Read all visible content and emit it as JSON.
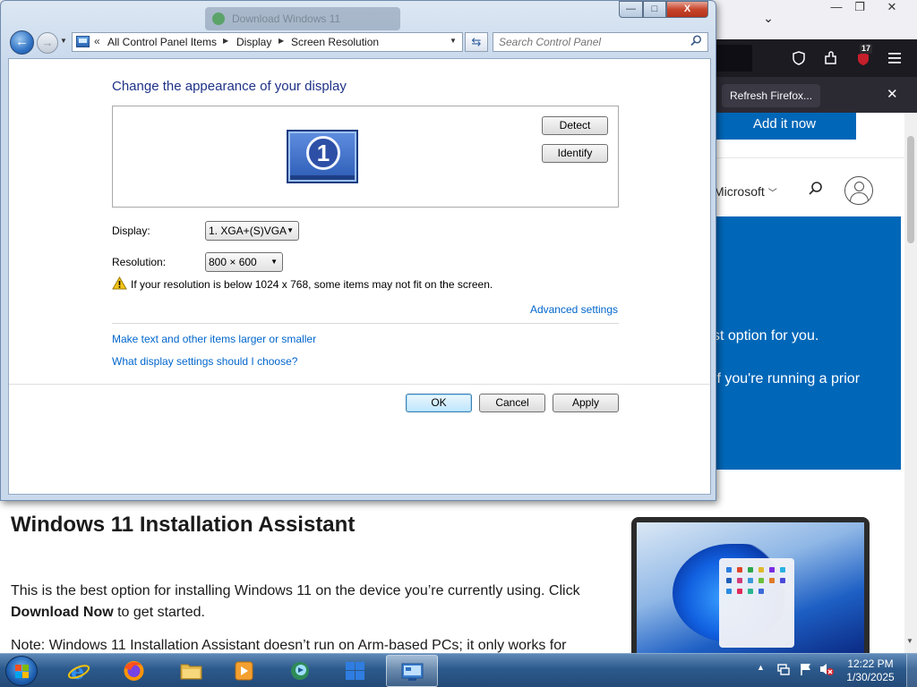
{
  "firefox": {
    "notification_button": "Refresh Firefox...",
    "notification_close": "✕",
    "tabstrip_chevron": "⌄",
    "badge_count": "17",
    "window_buttons": {
      "minimize": "—",
      "restore": "❐",
      "close": "✕"
    },
    "nav_icons": [
      "shield-icon",
      "extensions-icon",
      "ublock-icon",
      "menu-icon"
    ]
  },
  "webpage": {
    "add_it_now": "Add it now",
    "all_microsoft": "l Microsoft",
    "hero_line1": "st option for you.",
    "hero_line2": "If you're running a prior",
    "installer_title": "Windows 11 Installation Assistant",
    "installer_desc_pre": "This is the best option for installing Windows 11 on the device you’re currently using. Click ",
    "installer_desc_bold": "Download Now",
    "installer_desc_post": " to get started.",
    "installer_note": "Note: Windows 11 Installation Assistant doesn’t run on Arm-based PCs; it only works for"
  },
  "control_panel": {
    "ghost_tab_title": "Download Windows 11",
    "window_buttons": {
      "minimize": "—",
      "maximize": "□",
      "close": "X"
    },
    "breadcrumb": [
      "All Control Panel Items",
      "Display",
      "Screen Resolution"
    ],
    "search_placeholder": "Search Control Panel",
    "heading": "Change the appearance of your display",
    "monitor_number": "1",
    "detect_label": "Detect",
    "identify_label": "Identify",
    "display_label": "Display:",
    "display_value": "1. XGA+(S)VGA",
    "resolution_label": "Resolution:",
    "resolution_value": "800 × 600",
    "warning_text": "If your resolution is below 1024 x 768, some items may not fit on the screen.",
    "advanced_settings": "Advanced settings",
    "link_larger": "Make text and other items larger or smaller",
    "link_choose": "What display settings should I choose?",
    "ok_label": "OK",
    "cancel_label": "Cancel",
    "apply_label": "Apply"
  },
  "taskbar": {
    "items": [
      "internet-explorer",
      "firefox",
      "windows-explorer",
      "media-player",
      "remote-app",
      "windows-app",
      "control-panel"
    ],
    "active_item": "control-panel",
    "clock_time": "12:22 PM",
    "clock_date": "1/30/2025"
  },
  "colors": {
    "link_blue": "#0066cc",
    "heading_blue": "#1e3287",
    "microsoft_blue": "#0067b8",
    "firefox_dark": "#1c1b22"
  }
}
